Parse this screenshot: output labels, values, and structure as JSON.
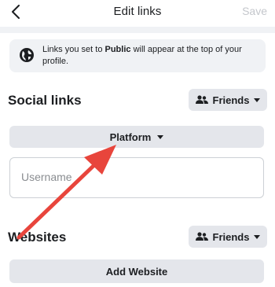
{
  "header": {
    "title": "Edit links",
    "save_label": "Save",
    "back_icon": "chevron-left-icon"
  },
  "notice": {
    "icon": "globe-icon",
    "text_before": "Links you set to ",
    "text_bold": "Public",
    "text_after": " will appear at the top of your profile."
  },
  "social": {
    "title": "Social links",
    "audience_label": "Friends",
    "platform_label": "Platform",
    "username_placeholder": "Username",
    "username_value": ""
  },
  "websites": {
    "title": "Websites",
    "audience_label": "Friends",
    "add_label": "Add Website"
  },
  "colors": {
    "annotation_arrow": "#e8453c",
    "button_bg": "#e4e6eb",
    "disabled_text": "#c4c7cc"
  }
}
